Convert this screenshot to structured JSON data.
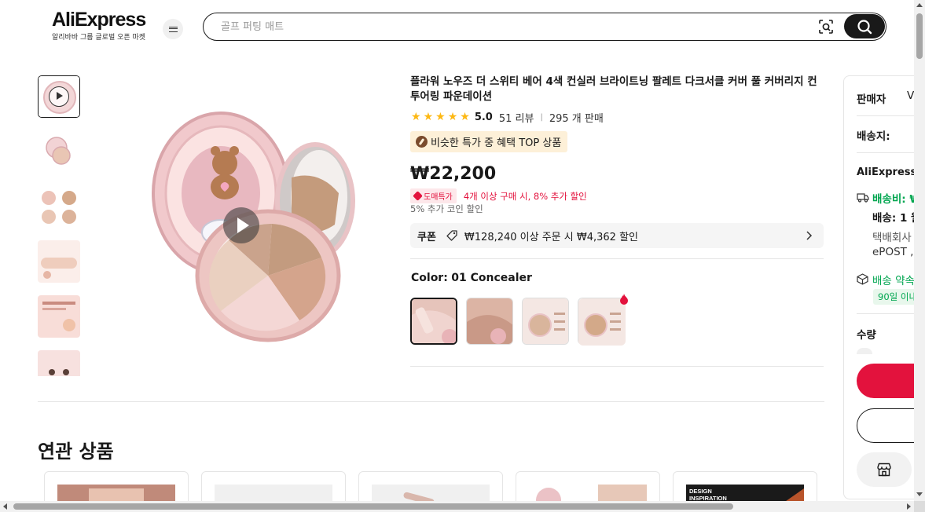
{
  "header": {
    "logo_text": "AliExpress",
    "logo_sub": "알리바바 그룹 글로벌 오픈 마켓",
    "search_placeholder": "골프 퍼팅 매트"
  },
  "product": {
    "title": "플라워 노우즈 더 스위티 베어 4색 컨실러 브라이트닝 팔레트 다크서클 커버 풀 커버리지 컨투어링 파운데이션",
    "rating": "5.0",
    "stars": 5,
    "reviews": "51 리뷰",
    "separator": "|",
    "sold": "295 개 판매",
    "top_badge": "비슷한 특가 중 혜택 TOP 상품",
    "price": "₩22,200",
    "promo_tag": "도매특가",
    "promo_text": "4개 이상 구매 시, 8% 추가 할인",
    "coin_text": "5% 추가 코인 할인",
    "coupon_label": "쿠폰",
    "coupon_text": "₩128,240 이상 주문 시 ₩4,362 할인",
    "color_label": "Color:",
    "color_value": "01 Concealer"
  },
  "related": {
    "title": "연관 상품",
    "cards": [
      "",
      "",
      "",
      "",
      "DESIGN INSPIRATION"
    ]
  },
  "side": {
    "seller_label": "판매자",
    "seller_value": "V",
    "ship_to_label": "배송지:",
    "shipper": "AliExpress",
    "shipping_fee": "배송비: ₩",
    "delivery": "배송: 1 월",
    "courier1": "택배회사",
    "courier2": "ePOST ,",
    "promise": "배송 약속",
    "promise_pill": "90일 이내",
    "qty_label": "수량"
  },
  "colors": {
    "accent": "#e3123d",
    "green": "#00a650",
    "star": "#fdb813"
  }
}
